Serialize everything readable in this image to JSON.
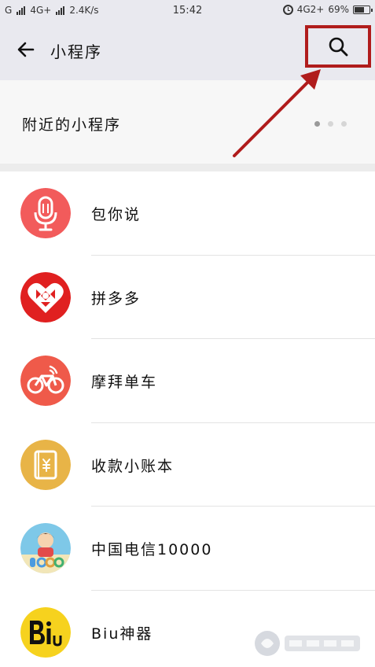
{
  "status_bar": {
    "carrier1": "G",
    "carrier2": "4G+",
    "speed": "2.4K/s",
    "time": "15:42",
    "network": "4G2+",
    "battery": "69%",
    "battery_level": 0.69
  },
  "header": {
    "title": "小程序",
    "back_icon": "arrow-left-icon",
    "search_icon": "search-icon"
  },
  "nearby": {
    "label": "附近的小程序",
    "dots_total": 3,
    "dots_active": 0
  },
  "apps": [
    {
      "name": "包你说",
      "icon": "microphone-icon",
      "color": "#f25b5b"
    },
    {
      "name": "拼多多",
      "icon": "pinduoduo-heart-icon",
      "color": "#e02020"
    },
    {
      "name": "摩拜单车",
      "icon": "bicycle-icon",
      "color": "#ef5a4a"
    },
    {
      "name": "收款小账本",
      "icon": "ledger-icon",
      "color": "#e8b447"
    },
    {
      "name": "中国电信10000",
      "icon": "avatar-icon",
      "color": "#7ec8e8"
    },
    {
      "name": "Biu神器",
      "icon": "biu-logo-icon",
      "color": "#f6d21e"
    }
  ],
  "annotation": {
    "highlight_color": "#b01c1c"
  }
}
